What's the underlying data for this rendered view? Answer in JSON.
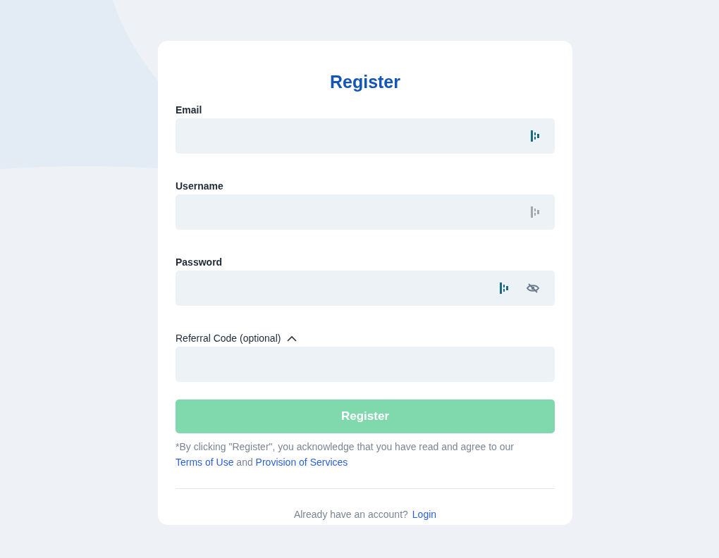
{
  "title": "Register",
  "fields": [
    {
      "label": "Email",
      "autofill_active": true,
      "reveal_toggle": false
    },
    {
      "label": "Username",
      "autofill_active": false,
      "reveal_toggle": false
    },
    {
      "label": "Password",
      "autofill_active": true,
      "reveal_toggle": true
    }
  ],
  "referral": {
    "label": "Referral Code (optional)",
    "expanded": true
  },
  "submit": {
    "label": "Register",
    "disabled": true
  },
  "consent": {
    "text": "*By clicking \"Register\", you acknowledge that you have read and agree to our",
    "link_1": "Terms of Use",
    "joiner": "and",
    "link_2": "Provision of Services"
  },
  "footer": {
    "prompt": "Already have an account?",
    "link": "Login"
  }
}
